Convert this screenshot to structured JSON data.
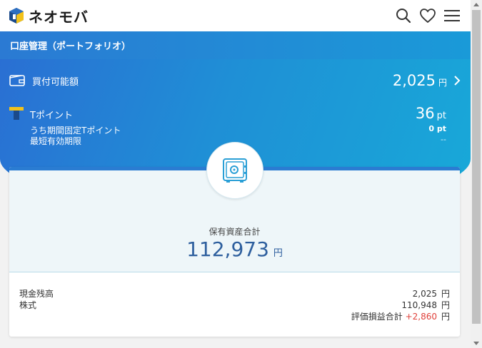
{
  "header": {
    "brand": "ネオモバ"
  },
  "subhead": {
    "title": "口座管理（ポートフォリオ）"
  },
  "buying_power": {
    "label": "買付可能額",
    "amount": "2,025",
    "unit": "円"
  },
  "tpoint": {
    "label": "Tポイント",
    "value": "36",
    "unit": "pt",
    "limited_label": "うち期間固定Tポイント",
    "limited_value": "0 pt",
    "expiry_label": "最短有効期限",
    "expiry_value": "--"
  },
  "total": {
    "label": "保有資産合計",
    "amount": "112,973",
    "unit": "円"
  },
  "breakdown": [
    {
      "label": "現金残高",
      "value": "2,025",
      "unit": "円"
    },
    {
      "label": "株式",
      "value": "110,948",
      "unit": "円"
    },
    {
      "label": "評価損益合計",
      "value": "+2,860",
      "unit": "円"
    }
  ],
  "colors": {
    "accent_blue": "#2a7cd2",
    "profit_red": "#e0403a"
  }
}
